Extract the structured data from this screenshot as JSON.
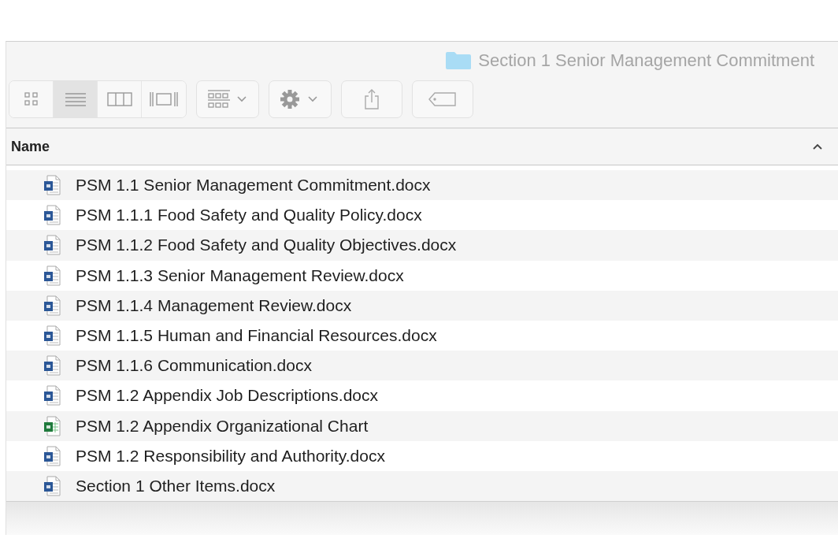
{
  "window": {
    "title": "Section 1 Senior Management Commitment"
  },
  "view_modes": [
    {
      "kind": "icons",
      "selected": false
    },
    {
      "kind": "list",
      "selected": true
    },
    {
      "kind": "columns",
      "selected": false
    },
    {
      "kind": "coverflow",
      "selected": false
    }
  ],
  "table": {
    "columns": [
      {
        "label": "Name",
        "sorted_ascending": true
      }
    ],
    "rows": [
      {
        "name": "PSM 1.1 Senior Management Commitment.docx",
        "kind": "word"
      },
      {
        "name": "PSM 1.1.1 Food Safety and Quality Policy.docx",
        "kind": "word"
      },
      {
        "name": "PSM 1.1.2 Food Safety and Quality Objectives.docx",
        "kind": "word"
      },
      {
        "name": "PSM 1.1.3 Senior Management Review.docx",
        "kind": "word"
      },
      {
        "name": "PSM 1.1.4 Management Review.docx",
        "kind": "word"
      },
      {
        "name": "PSM 1.1.5 Human and Financial Resources.docx",
        "kind": "word"
      },
      {
        "name": "PSM 1.1.6 Communication.docx",
        "kind": "word"
      },
      {
        "name": "PSM 1.2 Appendix Job Descriptions.docx",
        "kind": "word"
      },
      {
        "name": "PSM 1.2 Appendix Organizational Chart",
        "kind": "excel"
      },
      {
        "name": "PSM 1.2 Responsibility and Authority.docx",
        "kind": "word"
      },
      {
        "name": "Section 1 Other Items.docx",
        "kind": "word"
      }
    ]
  }
}
